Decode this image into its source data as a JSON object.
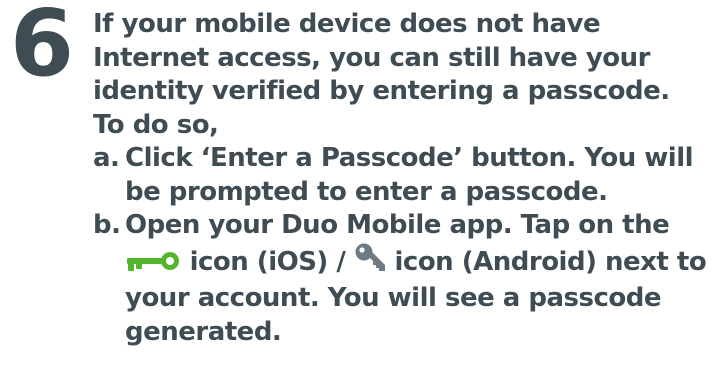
{
  "step": {
    "number": "6",
    "intro": "If your mobile device does not have Internet access, you can still have your identity verified by entering a passcode. To do so,",
    "items": [
      {
        "marker": "a.",
        "text": "Click ‘Enter a Passcode’ button. You will be prompted to enter a passcode."
      },
      {
        "marker": "b.",
        "text_before_icons": "Open your Duo Mobile app. Tap on the",
        "ios_suffix": "icon (iOS) /",
        "android_suffix": "icon (Android) next to your account. You will see a passcode generated."
      }
    ]
  },
  "icons": {
    "ios_key": "green-key-icon",
    "android_key": "gray-key-icon"
  },
  "colors": {
    "text": "#3f4c54",
    "ios_key": "#55b62e",
    "android_key": "#707a82"
  }
}
